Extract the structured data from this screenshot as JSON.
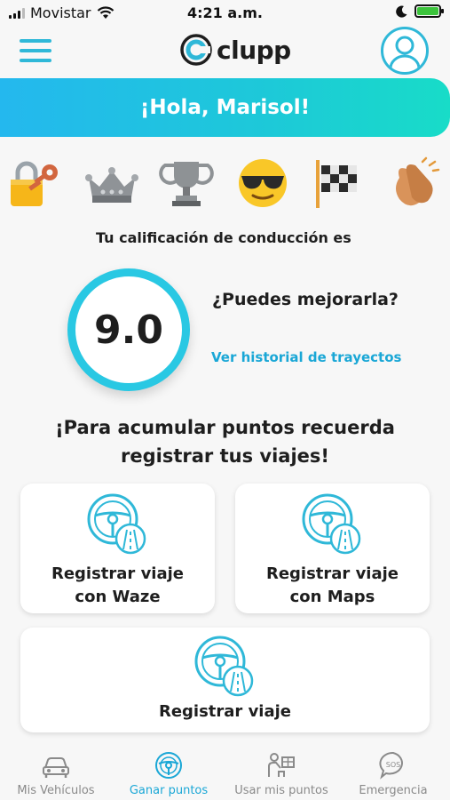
{
  "status_bar": {
    "carrier": "Movistar",
    "time": "4:21 a.m.",
    "wifi_icon": "wifi-icon",
    "moon_icon": "moon-icon",
    "battery_icon": "battery-charging-icon"
  },
  "header": {
    "brand_name": "clupp",
    "menu_icon": "hamburger-menu-icon",
    "avatar_icon": "user-avatar-icon"
  },
  "greeting": "¡Hola, Marisol!",
  "badges": [
    {
      "name": "lock-key-icon"
    },
    {
      "name": "crown-icon"
    },
    {
      "name": "trophy-icon"
    },
    {
      "name": "sunglasses-face-icon"
    },
    {
      "name": "checkered-flag-icon"
    },
    {
      "name": "clapping-hands-icon"
    }
  ],
  "rating": {
    "label": "Tu calificación de conducción es",
    "score": "9.0",
    "question": "¿Puedes mejorarla?",
    "history_link": "Ver historial de trayectos"
  },
  "reminder": {
    "line1": "¡Para acumular puntos recuerda",
    "line2": "registrar tus viajes!"
  },
  "cards": {
    "waze": {
      "line1": "Registrar viaje",
      "line2": "con Waze"
    },
    "maps": {
      "line1": "Registrar viaje",
      "line2": "con Maps"
    },
    "register": {
      "label": "Registrar viaje"
    }
  },
  "nav": {
    "vehicles": "Mis Vehículos",
    "earn_points": "Ganar puntos",
    "use_points": "Usar mis puntos",
    "emergency": "Emergencia"
  },
  "colors": {
    "accent": "#2fb8d8",
    "link": "#1aa7d6",
    "banner_start": "#24b8ee",
    "banner_end": "#18dcc8",
    "score_ring": "#29c8e3"
  }
}
